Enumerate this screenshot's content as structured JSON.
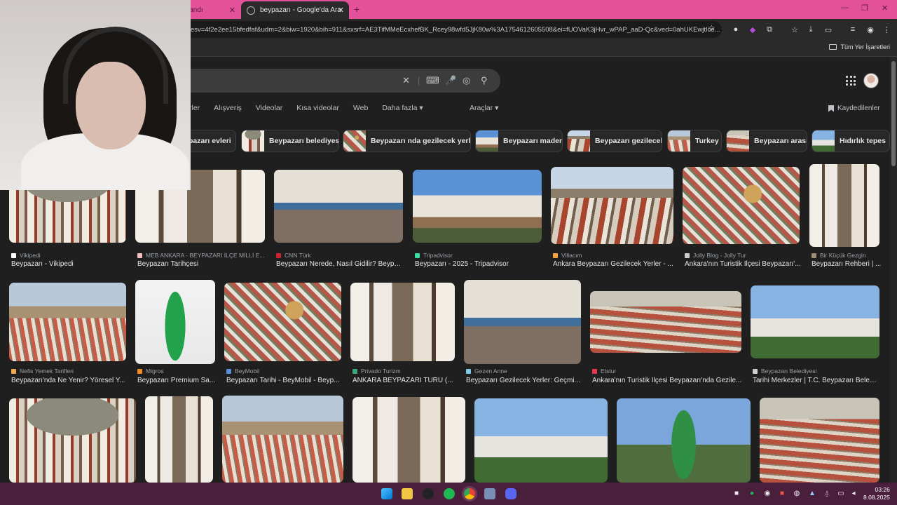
{
  "browser": {
    "tabs": [
      {
        "title": "miz ayrandı"
      },
      {
        "title": "beypazarı - Google'da Ara"
      }
    ],
    "address": "esv=4f2e2ee15bfedfaf&udm=2&biw=1920&bih=911&sxsrf=AE3TifMMeEcxhefBK_Rcey98wfd5JjK80w%3A1754612605508&ei=fUOVaK3jHvr_wPAP_aaD-Qc&ved=0ahUKEwjtIce...",
    "all_bookmarks": "Tüm Yer İşaretleri"
  },
  "filters": [
    "rler",
    "Alışveriş",
    "Videolar",
    "Kısa videolar",
    "Web",
    "Daha fazla ▾"
  ],
  "tools": "Araçlar ▾",
  "saved": "Kaydedilenler",
  "chips": [
    "pazarı evleri",
    "Beypazarı belediyesi",
    "Beypazarı nda gezilecek yerler",
    "Beypazarı maden",
    "Beypazarı gezilecek",
    "Turkey",
    "Beypazarı arası",
    "Hıdırlık tepes"
  ],
  "row1": [
    {
      "source": "Vikipedi",
      "title": "Beypazarı - Vikipedi",
      "color": "#ffffff"
    },
    {
      "source": "MEB ANKARA - BEYPAZARI İLÇE MİLLİ E...",
      "title": "Beypazarı Tarihçesi",
      "color": "#f3c0c0"
    },
    {
      "source": "CNN Türk",
      "title": "Beypazarı Nerede, Nasıl Gidilir? Beypa...",
      "color": "#d01f2e"
    },
    {
      "source": "Tripadvisor",
      "title": "Beypazarı - 2025 - Tripadvisor",
      "color": "#34e0a1"
    },
    {
      "source": "Villacım",
      "title": "Ankara Beypazarı Gezilecek Yerler - ...",
      "color": "#f4a340"
    },
    {
      "source": "Jolly Blog - Jolly Tur",
      "title": "Ankara'nın Turistik İlçesi Beypazarı'...",
      "color": "#cccccc"
    },
    {
      "source": "Bir Küçük Gezgin",
      "title": "Beypazarı Rehberi | ...",
      "color": "#9c8f7a"
    }
  ],
  "row2": [
    {
      "source": "Nefis Yemek Tarifleri",
      "title": "Beypazarı'nda Ne Yenir? Yöresel Y...",
      "color": "#f1a94e"
    },
    {
      "source": "Migros",
      "title": "Beypazarı Premium Sa...",
      "color": "#f28c1f"
    },
    {
      "source": "BeyMobil",
      "title": "Beypazarı Tarihi - BeyMobil - Beyp...",
      "color": "#5a8fd8"
    },
    {
      "source": "Privado Turizm",
      "title": "ANKARA BEYPAZARI TURU (...",
      "color": "#3aa87a"
    },
    {
      "source": "Gezen Anne",
      "title": "Beypazarı Gezilecek Yerler: Geçmi...",
      "color": "#7ec8e3"
    },
    {
      "source": "Etstur",
      "title": "Ankara'nın Turistik İlçesi Beypazarı'nda Gezile...",
      "color": "#e8384f"
    },
    {
      "source": "Beypazarı Belediyesi",
      "title": "Tarihi Merkezler | T.C. Beypazarı Beledi...",
      "color": "#cfcfcf"
    }
  ],
  "clock": {
    "time": "03:26",
    "date": "8.08.2025"
  }
}
